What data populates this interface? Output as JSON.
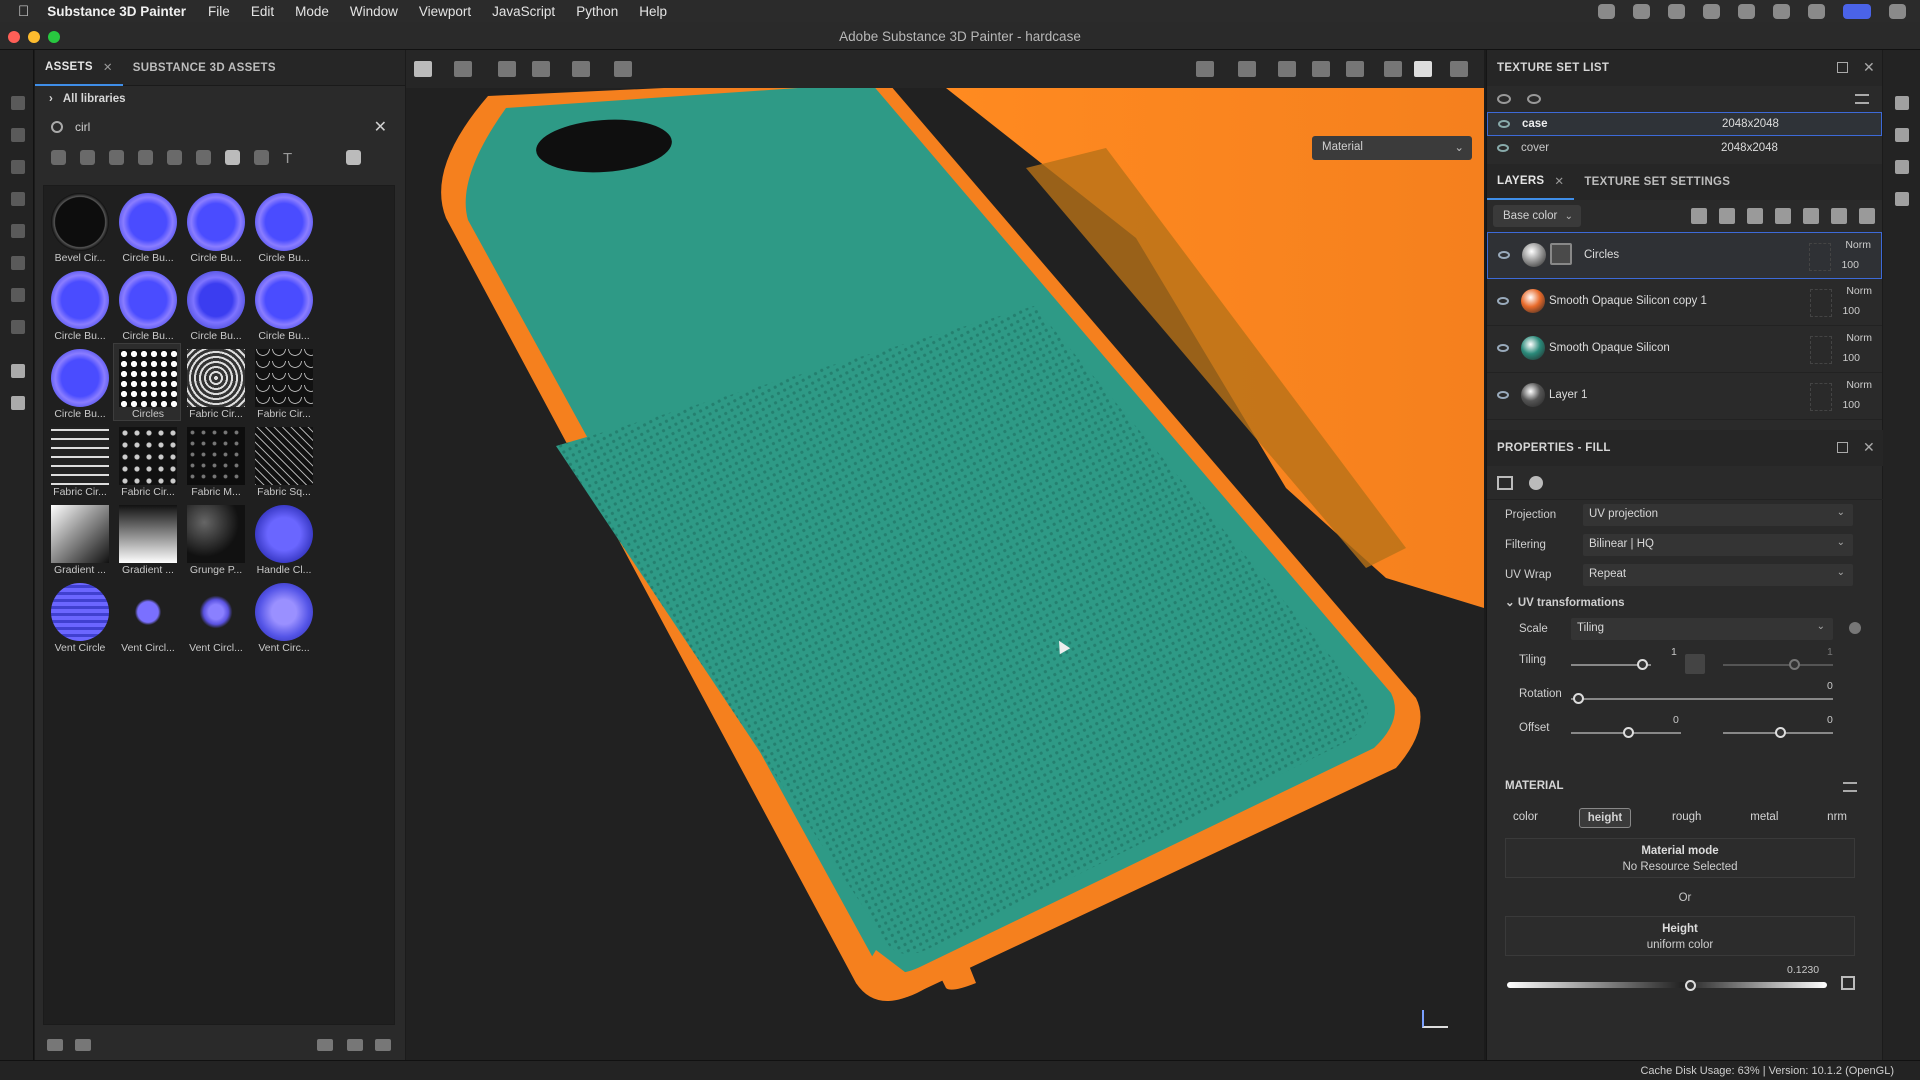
{
  "menubar": {
    "app_name": "Substance 3D Painter",
    "items": [
      "File",
      "Edit",
      "Mode",
      "Window",
      "Viewport",
      "JavaScript",
      "Python",
      "Help"
    ]
  },
  "window": {
    "title": "Adobe Substance 3D Painter - hardcase"
  },
  "assets": {
    "tabs": [
      {
        "label": "ASSETS"
      },
      {
        "label": "SUBSTANCE 3D ASSETS"
      }
    ],
    "library": "All libraries",
    "search_value": "cirl",
    "tiles": [
      {
        "label": "Bevel Cir...",
        "kind": "dark"
      },
      {
        "label": "Circle Bu...",
        "kind": "purple"
      },
      {
        "label": "Circle Bu...",
        "kind": "purple"
      },
      {
        "label": "Circle Bu...",
        "kind": "purple"
      },
      {
        "label": "Circle Bu...",
        "kind": "purple"
      },
      {
        "label": "Circle Bu...",
        "kind": "purple"
      },
      {
        "label": "Circle Bu...",
        "kind": "purple2"
      },
      {
        "label": "Circle Bu...",
        "kind": "purple"
      },
      {
        "label": "Circle Bu...",
        "kind": "purple"
      },
      {
        "label": "Circles",
        "kind": "dots"
      },
      {
        "label": "Fabric Cir...",
        "kind": "fab1"
      },
      {
        "label": "Fabric Cir...",
        "kind": "scales"
      },
      {
        "label": "Fabric Cir...",
        "kind": "fab2"
      },
      {
        "label": "Fabric Cir...",
        "kind": "fab3"
      },
      {
        "label": "Fabric M...",
        "kind": "fab4"
      },
      {
        "label": "Fabric Sq...",
        "kind": "fab5"
      },
      {
        "label": "Gradient ...",
        "kind": "grad1"
      },
      {
        "label": "Gradient ...",
        "kind": "grad2"
      },
      {
        "label": "Grunge P...",
        "kind": "grunge"
      },
      {
        "label": "Handle Cl...",
        "kind": "handle"
      },
      {
        "label": "Vent Circle",
        "kind": "vent1"
      },
      {
        "label": "Vent Circl...",
        "kind": "vent2"
      },
      {
        "label": "Vent Circl...",
        "kind": "vent3"
      },
      {
        "label": "Vent Circ...",
        "kind": "vent4"
      }
    ]
  },
  "viewport": {
    "mode_select": "Material"
  },
  "texture_set_list": {
    "title": "TEXTURE SET LIST",
    "rows": [
      {
        "name": "case",
        "resolution": "2048x2048"
      },
      {
        "name": "cover",
        "resolution": "2048x2048"
      }
    ]
  },
  "layers": {
    "tabs": [
      {
        "label": "LAYERS"
      },
      {
        "label": "TEXTURE SET SETTINGS"
      }
    ],
    "channel": "Base color",
    "items": [
      {
        "name": "Circles",
        "blend": "Norm",
        "opacity": "100",
        "color": "#9a9a9a"
      },
      {
        "name": "Smooth Opaque Silicon copy 1",
        "blend": "Norm",
        "opacity": "100",
        "color": "#e86a2a"
      },
      {
        "name": "Smooth Opaque Silicon",
        "blend": "Norm",
        "opacity": "100",
        "color": "#2a8a7a"
      },
      {
        "name": "Layer 1",
        "blend": "Norm",
        "opacity": "100",
        "color": "#555555"
      }
    ]
  },
  "properties": {
    "title": "PROPERTIES - FILL",
    "projection_label": "Projection",
    "projection": "UV projection",
    "filtering_label": "Filtering",
    "filtering": "Bilinear | HQ",
    "uvwrap_label": "UV Wrap",
    "uvwrap": "Repeat",
    "uvtrans_label": "UV transformations",
    "scale_label": "Scale",
    "scale": "Tiling",
    "tiling_label": "Tiling",
    "tiling_value": "1",
    "tiling_value2": "1",
    "rotation_label": "Rotation",
    "rotation_value": "0",
    "offset_label": "Offset",
    "offset_value": "0",
    "offset_value2": "0",
    "material_label": "MATERIAL",
    "channels": [
      "color",
      "height",
      "rough",
      "metal",
      "nrm"
    ],
    "material_mode": "Material mode",
    "no_resource": "No Resource Selected",
    "or": "Or",
    "height_title": "Height",
    "height_sub": "uniform color",
    "height_value": "0.1230"
  },
  "status": {
    "text": "Cache Disk Usage:    63% | Version: 10.1.2 (OpenGL)"
  },
  "colors": {
    "teal": "#2e9a86",
    "orange": "#f5801e",
    "accent": "#3d6ad8"
  }
}
